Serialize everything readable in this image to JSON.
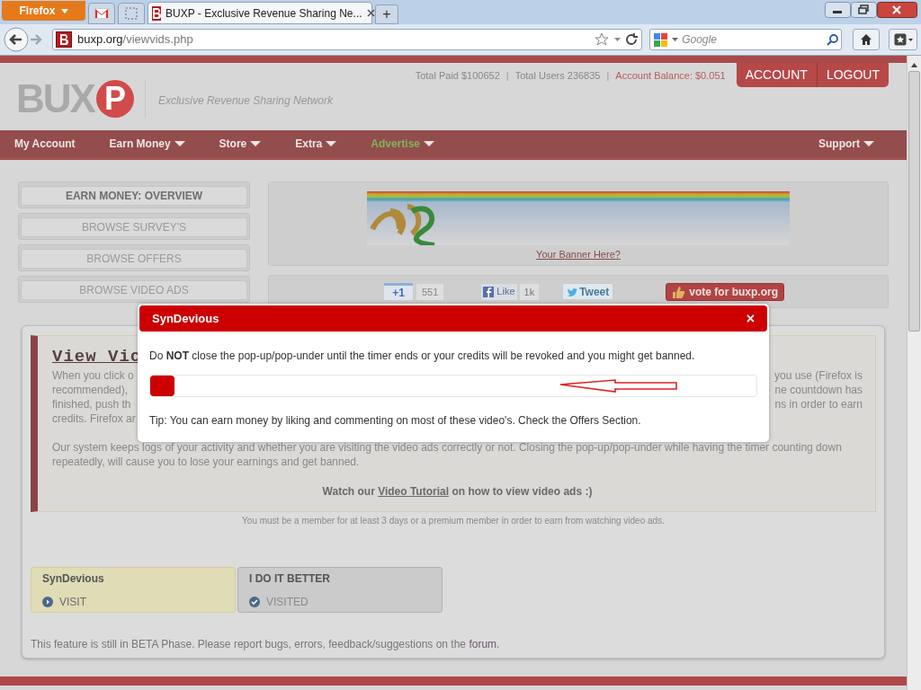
{
  "browser": {
    "menu_button": "Firefox",
    "tabs": [
      {
        "kind": "mail",
        "selected": false
      },
      {
        "kind": "blank",
        "selected": false
      },
      {
        "kind": "page",
        "title": "BUXP - Exclusive Revenue Sharing Ne...",
        "selected": true
      }
    ],
    "new_tab": "+",
    "url_domain": "buxp.org",
    "url_path": "/viewvids.php",
    "search_placeholder": "Google"
  },
  "header": {
    "separator": "|",
    "logo_main": "BUX",
    "logo_mark": "P",
    "tagline": "Exclusive Revenue Sharing Network",
    "stats": [
      {
        "text": "Total Paid $100652",
        "highlight": false
      },
      {
        "text": "Total Users 236835",
        "highlight": false
      },
      {
        "text": "Account Balance: $0.051",
        "highlight": true
      }
    ],
    "buttons": [
      "ACCOUNT",
      "LOGOUT"
    ]
  },
  "nav": {
    "items": [
      {
        "label": "My Account",
        "dropdown": false,
        "highlight": false
      },
      {
        "label": "Earn Money",
        "dropdown": true,
        "highlight": false
      },
      {
        "label": "Store",
        "dropdown": true,
        "highlight": false
      },
      {
        "label": "Extra",
        "dropdown": true,
        "highlight": false
      },
      {
        "label": "Advertise",
        "dropdown": true,
        "highlight": true
      }
    ],
    "right_item": {
      "label": "Support",
      "dropdown": true
    }
  },
  "sidebar": {
    "items": [
      {
        "label": "EARN MONEY: OVERVIEW",
        "selected": true
      },
      {
        "label": "BROWSE SURVEY'S",
        "selected": false
      },
      {
        "label": "BROWSE OFFERS",
        "selected": false
      },
      {
        "label": "BROWSE VIDEO ADS",
        "selected": false
      }
    ]
  },
  "banner": {
    "link": "Your Banner Here?"
  },
  "social": {
    "plus_one": "+1",
    "plus_count": "551",
    "like": "Like",
    "like_count": "1k",
    "tweet": "Tweet",
    "vote": "vote for buxp.org"
  },
  "main": {
    "heading": "View Vic",
    "left_fragments": [
      "When you click o",
      "recommended),",
      "finished, push th",
      "credits. Firefox ar"
    ],
    "right_fragments": [
      "you use (Firefox is",
      "ne countdown has",
      "ns in order to earn"
    ],
    "paragraph": "Our system keeps logs of your activity and whether you are visiting the video ads correctly or not. Closing the pop-up/pop-under while having the timer counting down repeatedly, will cause you to lose your earnings and get banned.",
    "tutorial_before": "Watch our",
    "tutorial_link": "Video Tutorial",
    "tutorial_after": "on how to view video ads :)",
    "member_note": "You must be a member for at least 3 days or a premium member in order to earn from watching video ads.",
    "ads": [
      {
        "name": "SynDevious",
        "action": "VISIT",
        "visited": false
      },
      {
        "name": "I DO IT BETTER",
        "action": "VISITED",
        "visited": true
      }
    ],
    "footer_text": "This feature is still in BETA Phase. Please report bugs, errors, feedback/suggestions on the",
    "footer_link": "forum",
    "footer_end": "."
  },
  "modal": {
    "title": "SynDevious",
    "close": "×",
    "message": "Do **NOT** close the pop-up/pop-under until the timer ends or your credits will be revoked and you might get banned.",
    "level": 0.04,
    "tip": "Tip: You can earn money by liking and commenting on most of these video's. Check the Offers Section."
  }
}
